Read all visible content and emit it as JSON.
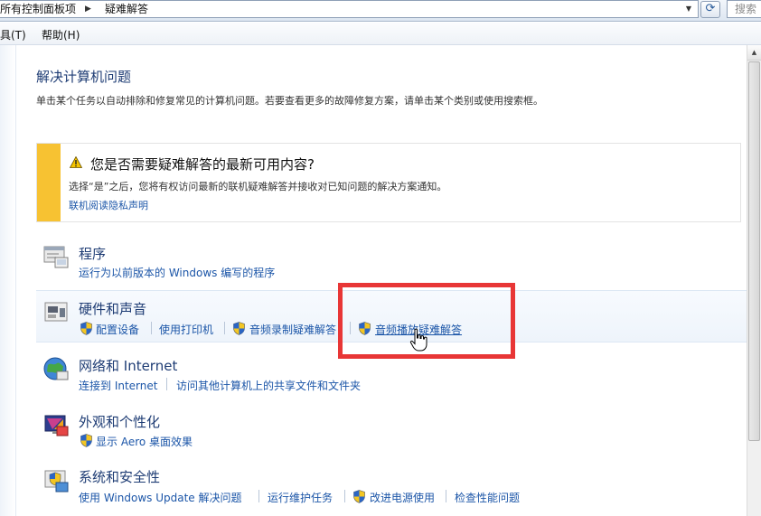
{
  "address_bar": {
    "crumbs": [
      "所有控制面板项",
      "疑难解答"
    ],
    "search_placeholder": "搜索"
  },
  "menu": {
    "items": [
      "工具(T)",
      "帮助(H)"
    ]
  },
  "page": {
    "title": "解决计算机问题",
    "description": "单击某个任务以自动排除和修复常见的计算机问题。若要查看更多的故障修复方案，请单击某个类别或使用搜索框。"
  },
  "notice": {
    "title": "您是否需要疑难解答的最新可用内容?",
    "body": "选择“是”之后，您将有权访问最新的联机疑难解答并接收对已知问题的解决方案通知。",
    "link": "联机阅读隐私声明",
    "accent_color": "#f7c232"
  },
  "categories": [
    {
      "title": "程序",
      "icon": "programs-icon",
      "tasks": [
        "运行为以前版本的 Windows 编写的程序"
      ]
    },
    {
      "title": "硬件和声音",
      "icon": "hardware-sound-icon",
      "tasks": [
        "配置设备",
        "使用打印机",
        "音频录制疑难解答",
        "音频播放疑难解答"
      ]
    },
    {
      "title": "网络和 Internet",
      "icon": "network-icon",
      "tasks": [
        "连接到 Internet",
        "访问其他计算机上的共享文件和文件夹"
      ]
    },
    {
      "title": "外观和个性化",
      "icon": "appearance-icon",
      "tasks": [
        "显示 Aero 桌面效果"
      ]
    },
    {
      "title": "系统和安全性",
      "icon": "system-security-icon",
      "tasks": [
        "使用 Windows Update 解决问题",
        "运行维护任务",
        "改进电源使用",
        "检查性能问题"
      ]
    }
  ],
  "colors": {
    "link": "#1c56a8",
    "heading": "#1e3c74",
    "annotation": "#e83636"
  }
}
